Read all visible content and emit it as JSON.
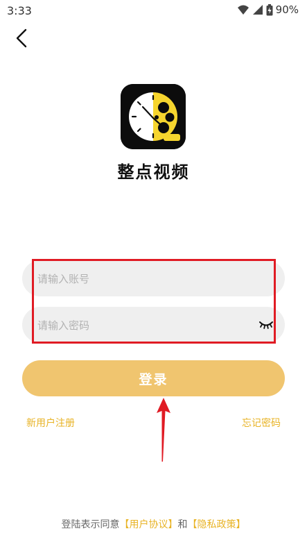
{
  "status_bar": {
    "time": "3:33",
    "battery": "90%",
    "icons": [
      "wifi-icon",
      "signal-icon",
      "battery-icon"
    ]
  },
  "nav": {
    "back_icon": "chevron-left-icon"
  },
  "app": {
    "name": "整点视频",
    "logo_icon": "clock-film-logo"
  },
  "form": {
    "account_placeholder": "请输入账号",
    "password_placeholder": "请输入密码",
    "eye_icon": "eye-closed-icon",
    "login_label": "登录"
  },
  "links": {
    "register": "新用户注册",
    "forgot_password": "忘记密码"
  },
  "agreement": {
    "prefix": "登陆表示同意",
    "user_agreement": "【用户协议】",
    "conjunction": "和",
    "privacy_policy": "【隐私政策】"
  },
  "colors": {
    "accent": "#F0C56F",
    "link": "#E8B325",
    "highlight_border": "#E01B24",
    "input_bg": "#EFEFEF",
    "logo_yellow": "#F6D52E"
  }
}
